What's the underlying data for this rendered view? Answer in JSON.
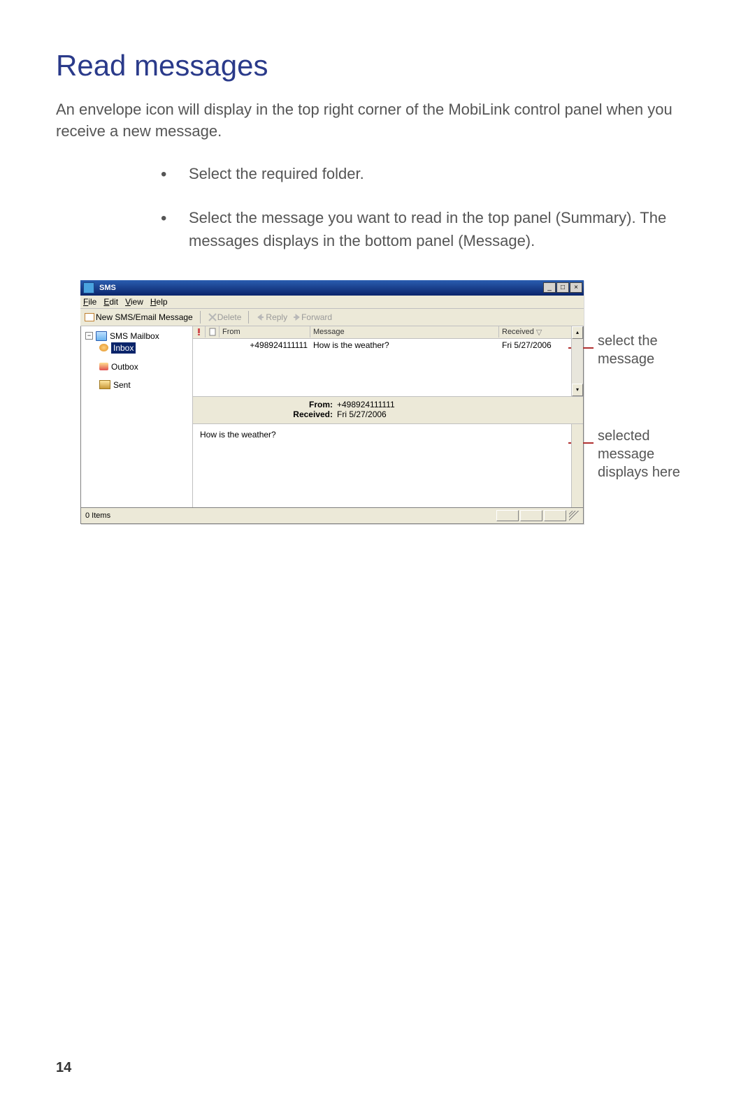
{
  "page": {
    "title": "Read messages",
    "intro": "An envelope icon will display in the top right corner of the MobiLink control panel when you receive a new message.",
    "bullet1": "Select the required folder.",
    "bullet2": "Select the message you want to read in the top panel (Summary). The messages displays in the bottom panel (Message).",
    "number": "14"
  },
  "callouts": {
    "top": "select the message",
    "bottom": "selected message displays here"
  },
  "win": {
    "title": "SMS",
    "minimize": "_",
    "maximize": "□",
    "close": "×"
  },
  "menu": {
    "file": "File",
    "edit": "Edit",
    "view": "View",
    "help": "Help"
  },
  "toolbar": {
    "new": "New SMS/Email Message",
    "delete": "Delete",
    "reply": "Reply",
    "forward": "Forward"
  },
  "tree": {
    "root": "SMS Mailbox",
    "inbox": "Inbox",
    "outbox": "Outbox",
    "sent": "Sent",
    "expander": "−"
  },
  "list": {
    "hdr": {
      "from": "From",
      "message": "Message",
      "received": "Received"
    },
    "sort_indicator": "▽",
    "rows": [
      {
        "from": "+498924111111",
        "message": "How is the weather?",
        "received": "Fri 5/27/2006"
      }
    ],
    "scroll_up": "▴",
    "scroll_down": "▾"
  },
  "detail": {
    "from_label": "From:",
    "from_value": "+498924111111",
    "received_label": "Received:",
    "received_value": "Fri 5/27/2006",
    "body": "How is the weather?"
  },
  "status": {
    "items": "0 Items"
  }
}
